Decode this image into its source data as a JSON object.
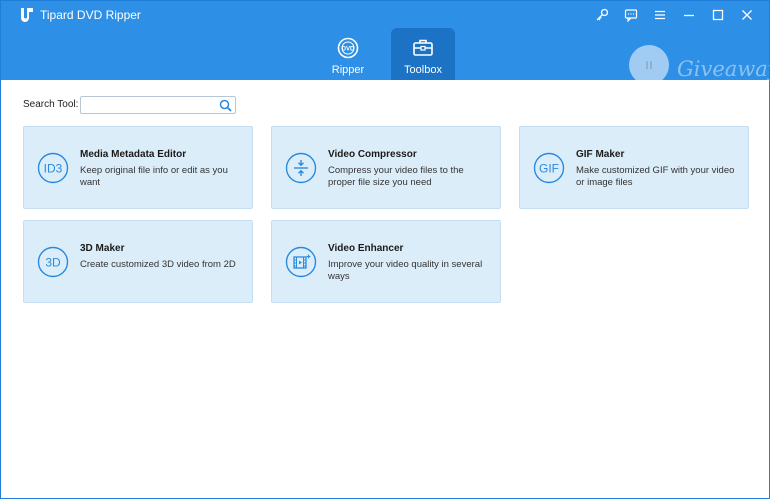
{
  "app": {
    "title": "Tipard DVD Ripper"
  },
  "title_controls": [
    "key-icon",
    "feedback-icon",
    "menu-icon",
    "minimize-icon",
    "maximize-icon",
    "close-icon"
  ],
  "tabs": [
    {
      "label": "Ripper",
      "icon": "dvd-icon",
      "active": false
    },
    {
      "label": "Toolbox",
      "icon": "toolbox-icon",
      "active": true
    }
  ],
  "watermark": {
    "text": "Giveaway"
  },
  "search": {
    "label": "Search Tool:",
    "value": "",
    "placeholder": ""
  },
  "tools": [
    {
      "title": "Media Metadata Editor",
      "description": "Keep original file info or edit as you want",
      "icon": "id3-icon",
      "icon_text": "ID3"
    },
    {
      "title": "Video Compressor",
      "description": "Compress your video files to the proper file size you need",
      "icon": "compress-icon",
      "icon_text": ""
    },
    {
      "title": "GIF Maker",
      "description": "Make customized GIF with your video or image files",
      "icon": "gif-icon",
      "icon_text": "GIF"
    },
    {
      "title": "3D Maker",
      "description": "Create customized 3D video from 2D",
      "icon": "3d-icon",
      "icon_text": "3D"
    },
    {
      "title": "Video Enhancer",
      "description": "Improve your video quality in several ways",
      "icon": "enhance-icon",
      "icon_text": ""
    }
  ],
  "colors": {
    "titlebar": "#2d8fe6",
    "active_tab": "#1c72c5",
    "card_bg": "#dcedfa",
    "accent": "#2a8ae0"
  }
}
